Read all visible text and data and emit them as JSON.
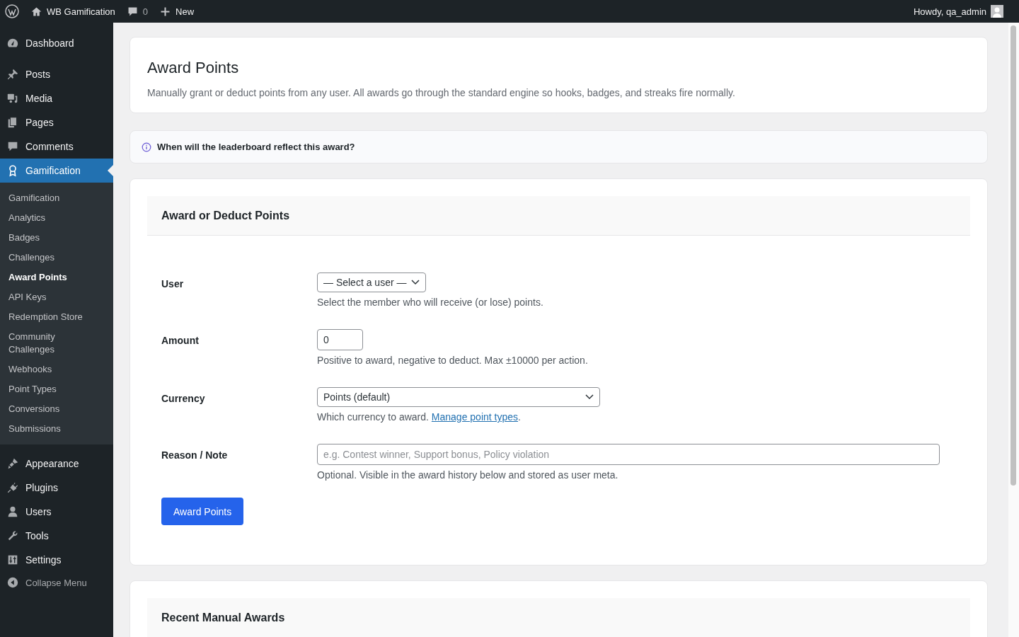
{
  "admin_bar": {
    "site_name": "WB Gamification",
    "comments_count": "0",
    "new_label": "New",
    "greeting": "Howdy, qa_admin"
  },
  "sidebar": {
    "items": [
      {
        "label": "Dashboard",
        "selected": false
      },
      {
        "label": "Posts",
        "selected": false
      },
      {
        "label": "Media",
        "selected": false
      },
      {
        "label": "Pages",
        "selected": false
      },
      {
        "label": "Comments",
        "selected": false
      },
      {
        "label": "Gamification",
        "selected": true,
        "children": [
          {
            "label": "Gamification",
            "selected": false
          },
          {
            "label": "Analytics",
            "selected": false
          },
          {
            "label": "Badges",
            "selected": false
          },
          {
            "label": "Challenges",
            "selected": false
          },
          {
            "label": "Award Points",
            "selected": true
          },
          {
            "label": "API Keys",
            "selected": false
          },
          {
            "label": "Redemption Store",
            "selected": false
          },
          {
            "label": "Community Challenges",
            "selected": false
          },
          {
            "label": "Webhooks",
            "selected": false
          },
          {
            "label": "Point Types",
            "selected": false
          },
          {
            "label": "Conversions",
            "selected": false
          },
          {
            "label": "Submissions",
            "selected": false
          }
        ]
      },
      {
        "label": "Appearance",
        "selected": false
      },
      {
        "label": "Plugins",
        "selected": false
      },
      {
        "label": "Users",
        "selected": false
      },
      {
        "label": "Tools",
        "selected": false
      },
      {
        "label": "Settings",
        "selected": false
      }
    ],
    "collapse_label": "Collapse Menu"
  },
  "page": {
    "title": "Award Points",
    "description": "Manually grant or deduct points from any user. All awards go through the standard engine so hooks, badges, and streaks fire normally."
  },
  "notice": {
    "text": "When will the leaderboard reflect this award?"
  },
  "form": {
    "heading": "Award or Deduct Points",
    "fields": [
      {
        "label": "User",
        "kind": "select",
        "value": "— Select a user —",
        "help": "Select the member who will receive (or lose) points."
      },
      {
        "label": "Amount",
        "kind": "number",
        "value": "0",
        "help": "Positive to award, negative to deduct. Max ±10000 per action."
      },
      {
        "label": "Currency",
        "kind": "wide-select",
        "value": "Points (default)",
        "help": "Which currency to award. ",
        "link": "Manage point types",
        "help_after": "."
      },
      {
        "label": "Reason / Note",
        "kind": "text",
        "placeholder": "e.g. Contest winner, Support bonus, Policy violation",
        "help": "Optional. Visible in the award history below and stored as user meta."
      }
    ],
    "submit": "Award Points"
  },
  "recent": {
    "heading": "Recent Manual Awards"
  }
}
